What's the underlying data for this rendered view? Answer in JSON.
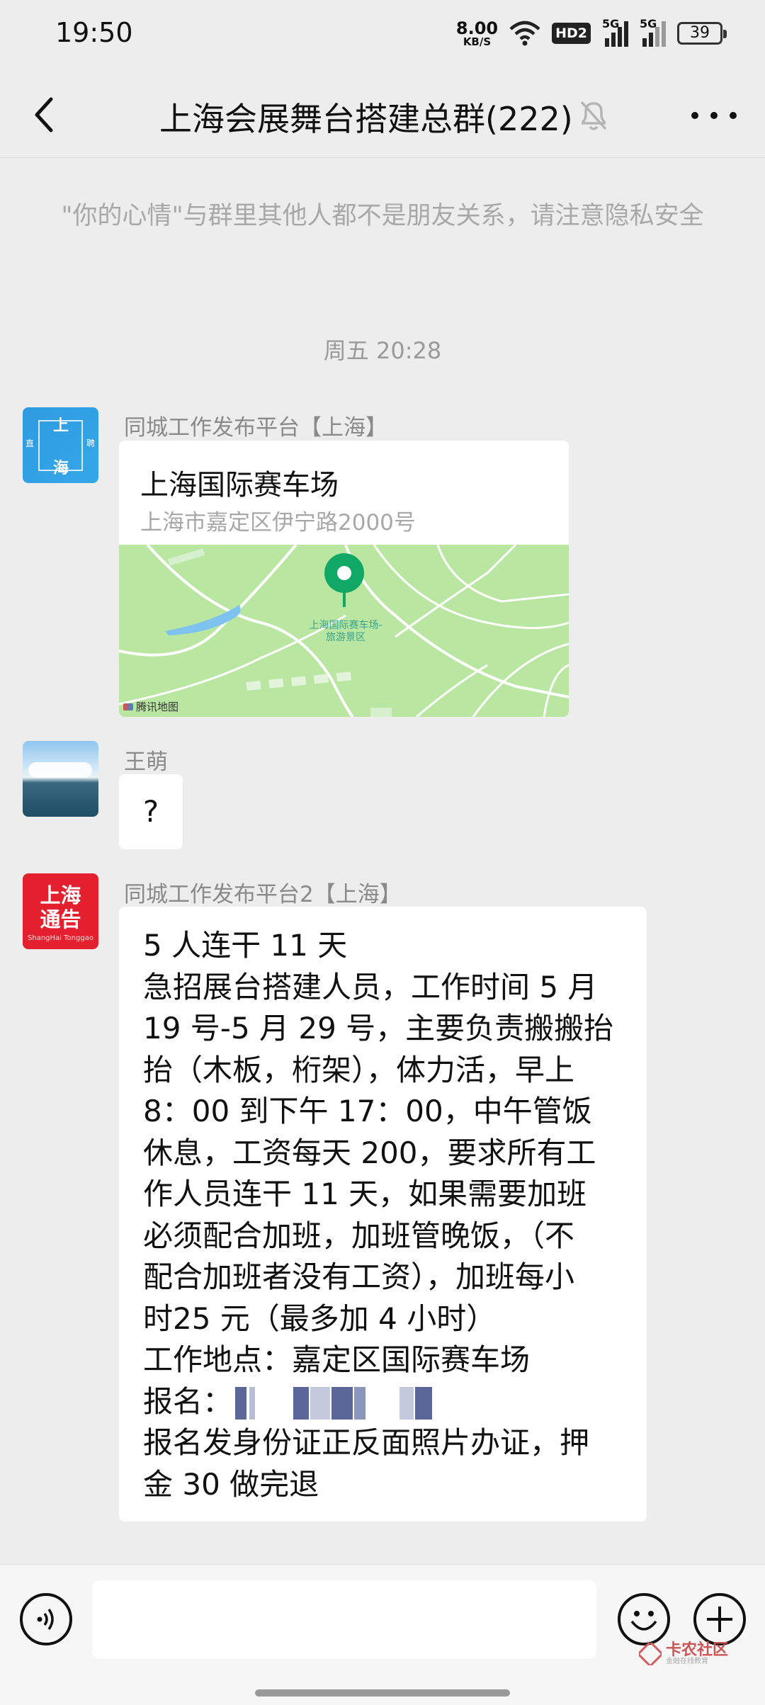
{
  "status_bar": {
    "time": "19:50",
    "net_speed_value": "8.00",
    "net_speed_unit": "KB/S",
    "hd_badge": "HD2",
    "signal1_label": "5G",
    "signal2_label": "5G",
    "battery": "39",
    "icons": [
      "wifi-icon",
      "signal-icon",
      "battery-icon"
    ]
  },
  "nav": {
    "title": "上海会展舞台搭建总群(222)",
    "back_icon": "chevron-left-icon",
    "mute_icon": "bell-muted-icon",
    "more_icon": "more-dots-icon"
  },
  "system_notice": "\"你的心情\"与群里其他人都不是朋友关系，请注意隐私安全",
  "timestamp": "周五 20:28",
  "messages": [
    {
      "sender": "同城工作发布平台【上海】",
      "avatar_text": [
        "上",
        "海",
        "直",
        "聘"
      ],
      "type": "location",
      "location_name": "上海国际赛车场",
      "location_address": "上海市嘉定区伊宁路2000号",
      "map_label": "上海国际赛车场-旅游景区",
      "map_provider": "腾讯地图"
    },
    {
      "sender": "王萌",
      "type": "text",
      "text": "?"
    },
    {
      "sender": "同城工作发布平台2【上海】",
      "avatar_text": [
        "上海",
        "通告",
        "ShangHai Tonggao"
      ],
      "type": "text",
      "lines": [
        "5 人连干 11 天",
        "急招展台搭建人员，工作时间 5 月",
        "19 号-5 月 29 号，主要负责搬搬抬",
        "抬（木板，桁架），体力活，早上",
        "8：00 到下午 17：00，中午管饭",
        "休息，工资每天 200，要求所有工",
        "作人员连干 11 天，如果需要加班",
        "必须配合加班，加班管晚饭，（不",
        "配合加班者没有工资），加班每小",
        "时25 元（最多加 4 小时）",
        "工作地点：嘉定区国际赛车场",
        "报名：",
        "报名发身份证正反面照片办证，押",
        "金 30 做完退"
      ]
    }
  ],
  "input_bar": {
    "voice_icon": "voice-icon",
    "emoji_icon": "emoji-icon",
    "plus_icon": "plus-icon",
    "watermark_main": "卡农社区",
    "watermark_sub": "金融在线教育"
  },
  "colors": {
    "background": "#ededed",
    "bubble": "#ffffff",
    "map_green": "#b9e6a0",
    "map_pin": "#0fa865"
  }
}
